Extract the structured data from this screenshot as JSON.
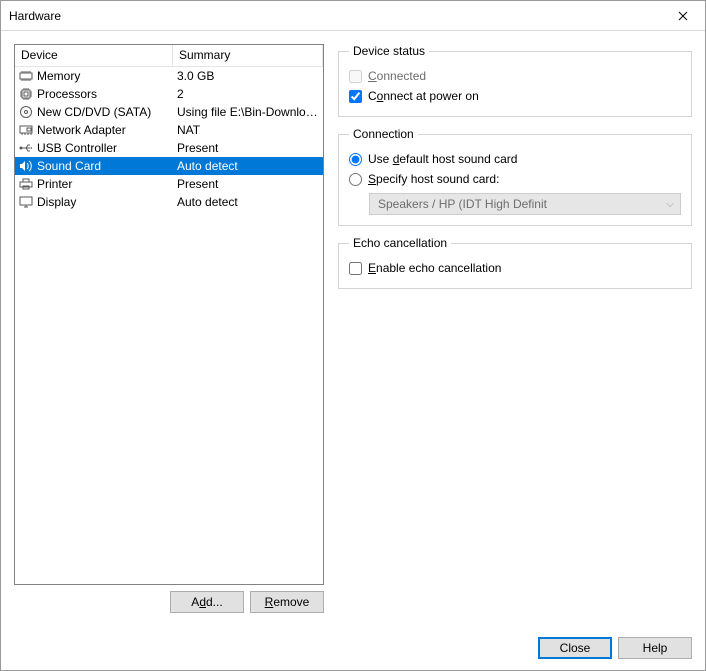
{
  "window": {
    "title": "Hardware"
  },
  "headers": {
    "device": "Device",
    "summary": "Summary"
  },
  "devices": [
    {
      "icon": "memory",
      "name": "Memory",
      "summary": "3.0 GB"
    },
    {
      "icon": "cpu",
      "name": "Processors",
      "summary": "2"
    },
    {
      "icon": "disc",
      "name": "New CD/DVD (SATA)",
      "summary": "Using file E:\\Bin-Downloads\\li..."
    },
    {
      "icon": "nic",
      "name": "Network Adapter",
      "summary": "NAT"
    },
    {
      "icon": "usb",
      "name": "USB Controller",
      "summary": "Present"
    },
    {
      "icon": "sound",
      "name": "Sound Card",
      "summary": "Auto detect",
      "selected": true
    },
    {
      "icon": "printer",
      "name": "Printer",
      "summary": "Present"
    },
    {
      "icon": "display",
      "name": "Display",
      "summary": "Auto detect"
    }
  ],
  "buttons": {
    "add_pre": "A",
    "add_ul": "d",
    "add_post": "d...",
    "remove_pre": "",
    "remove_ul": "R",
    "remove_post": "emove",
    "close": "Close",
    "help": "Help"
  },
  "panel": {
    "device_status": {
      "legend": "Device status",
      "connected_pre": "",
      "connected_ul": "C",
      "connected_post": "onnected",
      "connected_checked": false,
      "connected_enabled": false,
      "poweron_pre": "C",
      "poweron_ul": "o",
      "poweron_post": "nnect at power on",
      "poweron_checked": true
    },
    "connection": {
      "legend": "Connection",
      "default_pre": "Use ",
      "default_ul": "d",
      "default_post": "efault host sound card",
      "specify_pre": "",
      "specify_ul": "S",
      "specify_post": "pecify host sound card:",
      "mode": "default",
      "combo_value": "Speakers / HP (IDT High Definit"
    },
    "echo": {
      "legend": "Echo cancellation",
      "enable_pre": "",
      "enable_ul": "E",
      "enable_post": "nable echo cancellation",
      "checked": false
    }
  }
}
